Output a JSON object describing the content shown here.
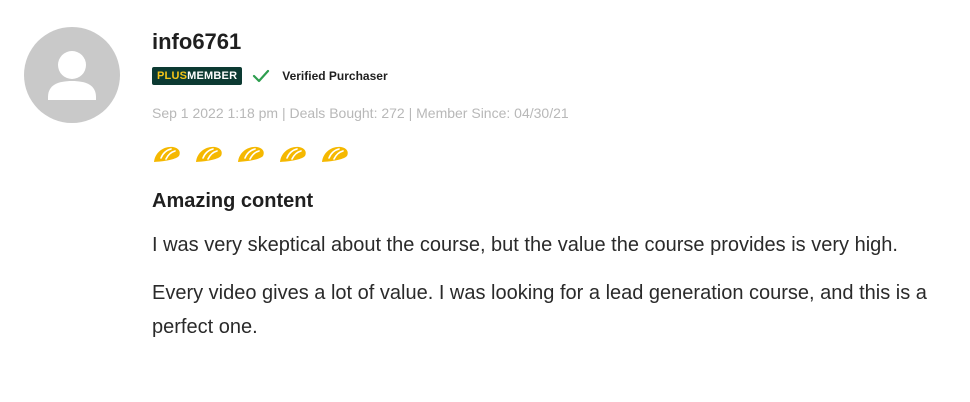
{
  "review": {
    "avatar_icon": "user-silhouette-icon",
    "username": "info6761",
    "plus_badge": {
      "plus": "PLUS",
      "member": "MEMBER"
    },
    "verified_icon": "checkmark-icon",
    "verified_label": "Verified Purchaser",
    "meta": "Sep 1 2022 1:18 pm | Deals Bought: 272 | Member Since: 04/30/21",
    "rating": 5,
    "rating_max": 5,
    "title": "Amazing content",
    "paragraphs": [
      "I was very skeptical about the course, but the value the course provides is very high.",
      "Every video gives a lot of value. I was looking for a lead generation course, and this is a perfect one."
    ]
  },
  "colors": {
    "avatar_bg": "#c9c9c9",
    "badge_bg": "#0c3a32",
    "badge_plus": "#f5c518",
    "check": "#2e9e4f",
    "star": "#f5b800",
    "meta_text": "#b8b8b8"
  }
}
